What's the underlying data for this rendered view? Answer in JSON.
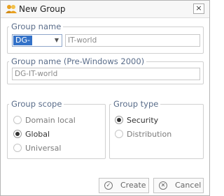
{
  "window": {
    "title": "New Group",
    "close_glyph": "×",
    "app_icon": "group-users-icon"
  },
  "group_name": {
    "legend": "Group name",
    "prefix_value": "DG-",
    "value": "IT-world"
  },
  "pre_windows": {
    "legend": "Group name (Pre-Windows 2000)",
    "value": "DG-IT-world"
  },
  "scope": {
    "legend": "Group scope",
    "options": [
      "Domain local",
      "Global",
      "Universal"
    ],
    "selected": "Global"
  },
  "type": {
    "legend": "Group type",
    "options": [
      "Security",
      "Distribution"
    ],
    "selected": "Security"
  },
  "buttons": {
    "create": "Create",
    "cancel": "Cancel"
  },
  "colors": {
    "legend": "#5a6d8a",
    "selection": "#3271c8"
  }
}
